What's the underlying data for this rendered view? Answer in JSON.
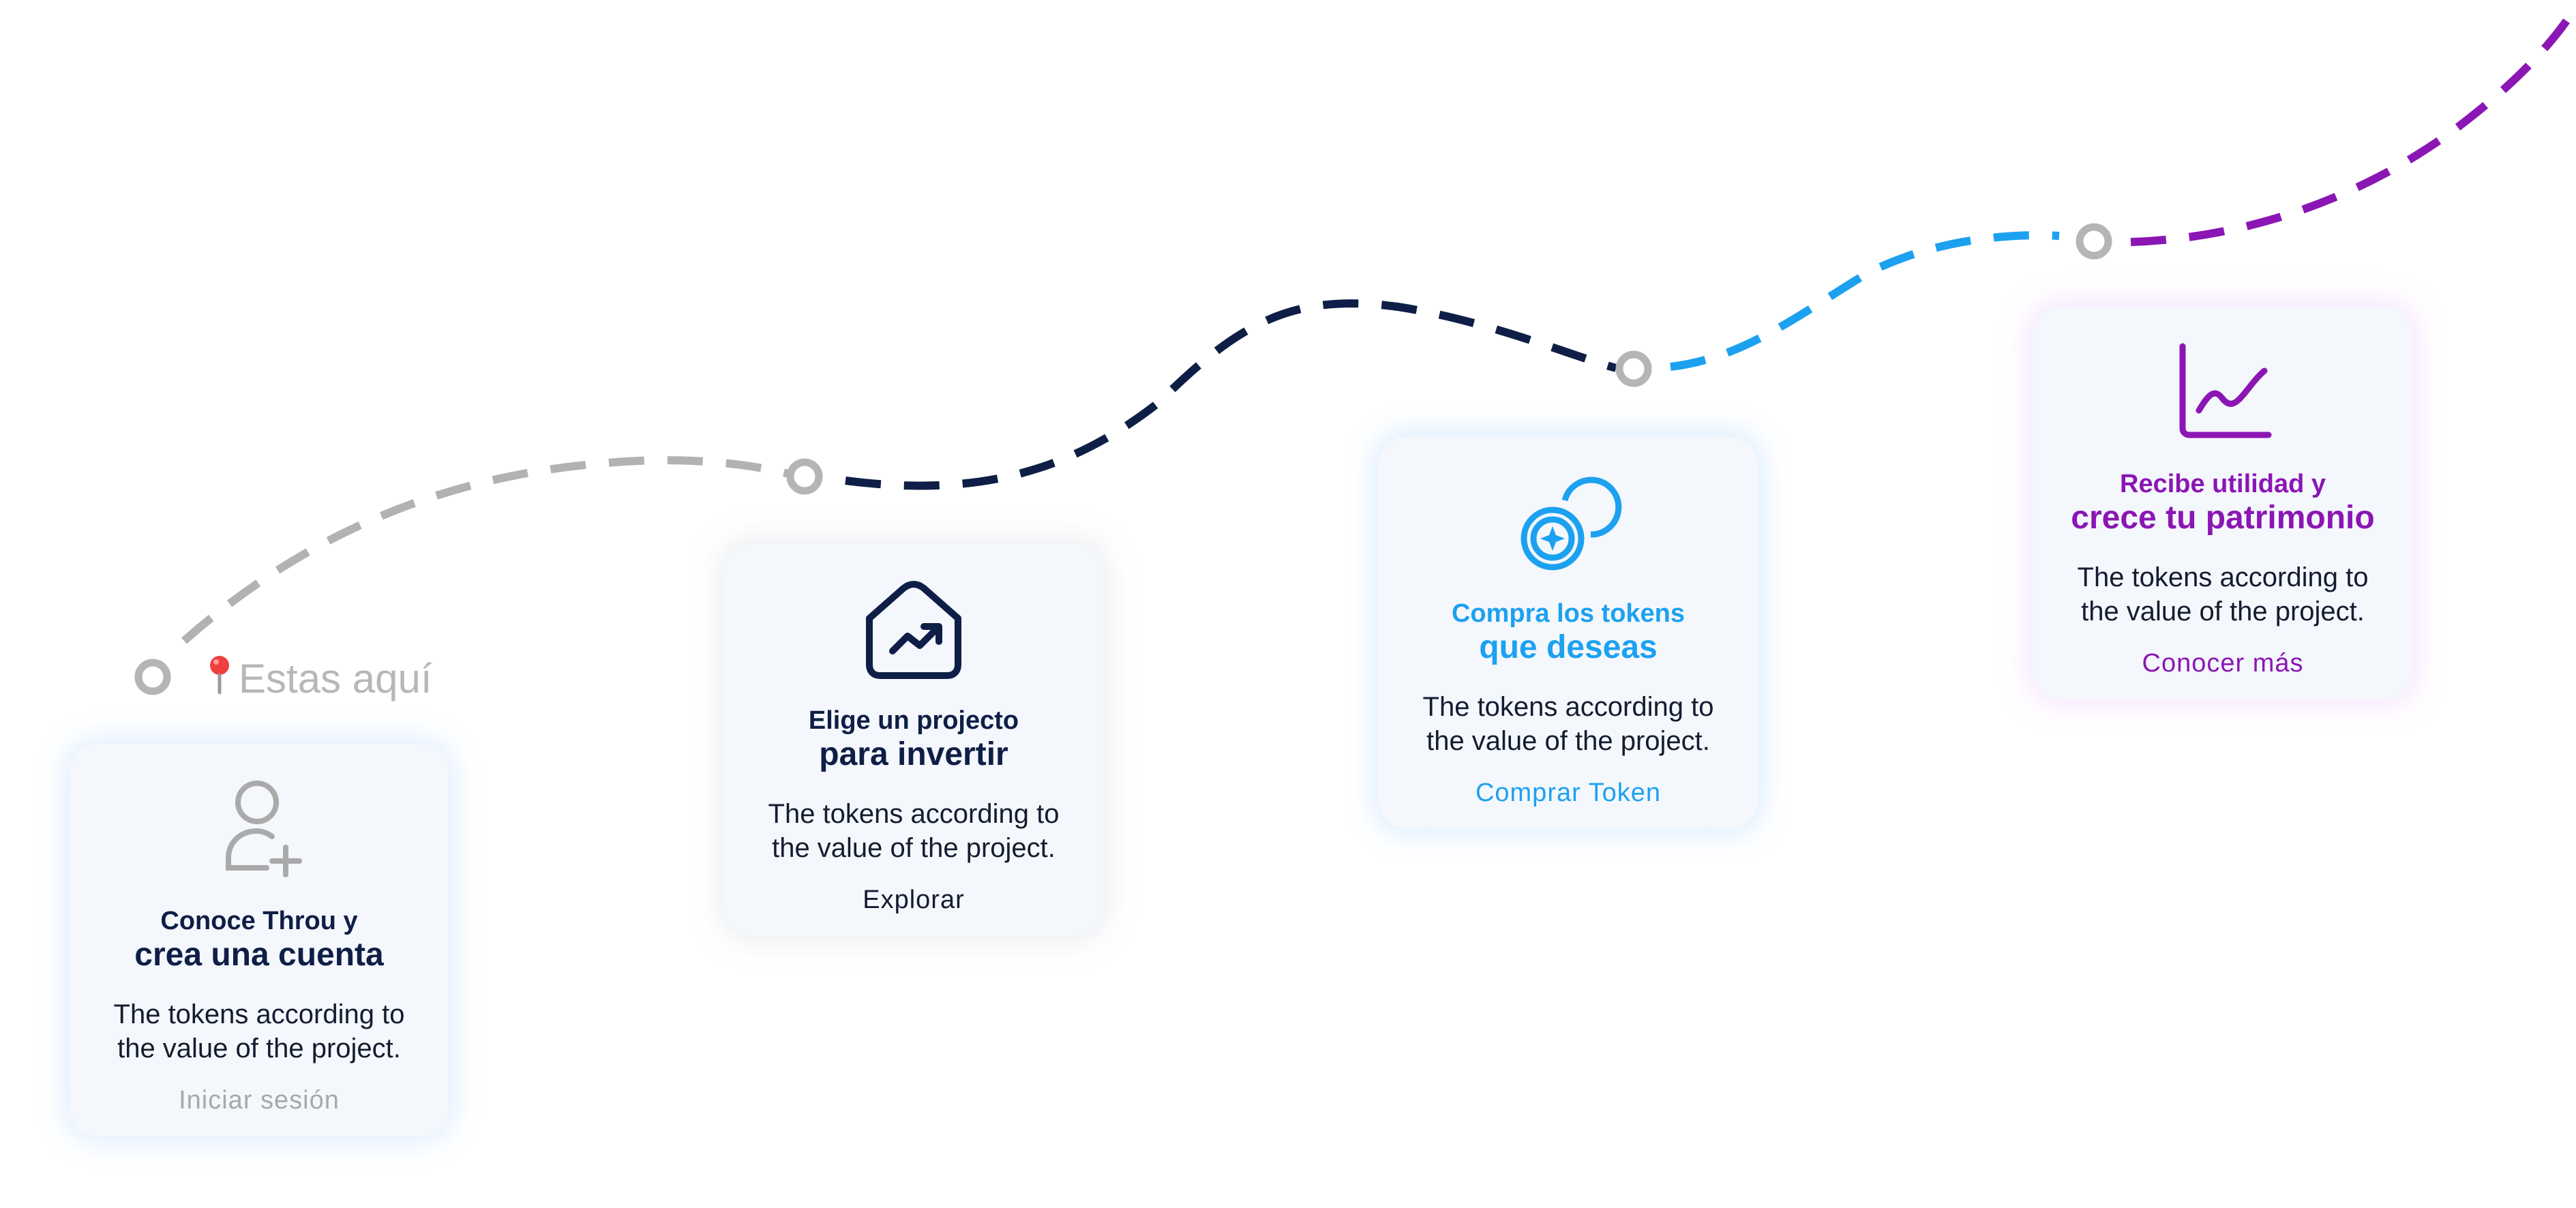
{
  "marker": {
    "label": "Estas aquí",
    "icon": "map-pin-icon"
  },
  "path_colors": {
    "step1": "#b2b2b2",
    "step2": "#0e1e46",
    "step3": "#1ca1f0",
    "step4": "#8b16b4",
    "dot": "#b5b5b5"
  },
  "steps": [
    {
      "title_small": "Conoce Throu y",
      "title_large": "crea una cuenta",
      "description": "The tokens according to the value of the project.",
      "link": "Iniciar sesión",
      "icon": "user-add-icon",
      "color": "#0e1e46",
      "icon_color": "#aaaaaa",
      "link_color": "#a8a8a8"
    },
    {
      "title_small": "Elige un projecto",
      "title_large": "para invertir",
      "description": "The tokens according to the value of the project.",
      "link": "Explorar",
      "icon": "house-trend-icon",
      "color": "#0e1e46",
      "icon_color": "#0e1e46",
      "link_color": "#141c30"
    },
    {
      "title_small": "Compra los tokens",
      "title_large": "que deseas",
      "description": "The tokens according to the value of the project.",
      "link": "Comprar Token",
      "icon": "coins-icon",
      "color": "#1ca1f0",
      "icon_color": "#1ca1f0",
      "link_color": "#1ca1f0"
    },
    {
      "title_small": "Recibe utilidad y",
      "title_large": "crece tu patrimonio",
      "description": "The tokens according to the value of the project.",
      "link": "Conocer más",
      "icon": "line-chart-icon",
      "color": "#8b16b4",
      "icon_color": "#8b16b4",
      "link_color": "#8b16b4"
    }
  ]
}
